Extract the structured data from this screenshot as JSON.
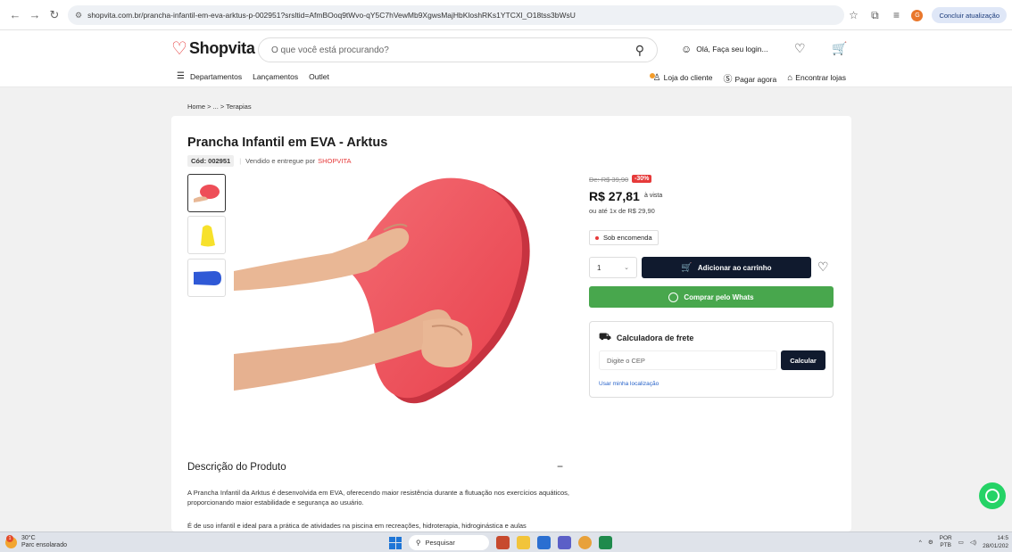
{
  "browser": {
    "url": "shopvita.com.br/prancha-infantil-em-eva-arktus-p-002951?srsltid=AfmBOoq9tWvo-qY5C7hVewMb9XgwsMajHbKloshRKs1YTCXl_O18tss3bWsU",
    "update_label": "Concluir atualização",
    "profile_initial": "G"
  },
  "header": {
    "logo_text": "Shopvita",
    "search_placeholder": "O que você está procurando?",
    "login_label": "Olá, Faça seu login...",
    "nav": [
      "Departamentos",
      "Lançamentos",
      "Outlet"
    ],
    "nav_right": [
      "Loja do cliente",
      "Pagar agora",
      "Encontrar lojas"
    ]
  },
  "breadcrumb": "Home  >  ...  >  Terapias",
  "product": {
    "title": "Prancha Infantil em EVA - Arktus",
    "code": "Cód: 002951",
    "sold_by_prefix": "Vendido e entregue por",
    "seller": "SHOPVITA",
    "old_price": "De: R$ 39,90",
    "discount": "-30%",
    "price": "R$ 27,81",
    "price_suffix": "à vista",
    "installment": "ou até 1x de R$ 29,90",
    "availability": "Sob encomenda",
    "quantity": "1",
    "add_to_cart": "Adicionar ao carrinho",
    "buy_whats": "Comprar pelo Whats"
  },
  "frete": {
    "title": "Calculadora de frete",
    "cep_placeholder": "Digite o CEP",
    "calc_button": "Calcular",
    "location_link": "Usar minha localização"
  },
  "description": {
    "title": "Descrição do Produto",
    "toggle": "−",
    "p1": "A Prancha Infantil da Arktus é desenvolvida em EVA, oferecendo maior resistência durante a flutuação nos exercícios aquáticos, proporcionando maior estabilidade e segurança ao usuário.",
    "p2": "É de uso infantil e ideal para a prática de atividades na piscina em recreações, hidroterapia, hidroginástica e aulas"
  },
  "taskbar": {
    "temp": "30°C",
    "weather": "Parc ensolarado",
    "alert_count": "1",
    "search_label": "Pesquisar",
    "lang_top": "POR",
    "lang_bottom": "PTB",
    "time": "14:5",
    "date": "28/01/202"
  },
  "colors": {
    "brand_red": "#e63a3a",
    "dark_button": "#101a2e",
    "whats_green": "#48a74d",
    "board_red": "#ee4e58"
  }
}
